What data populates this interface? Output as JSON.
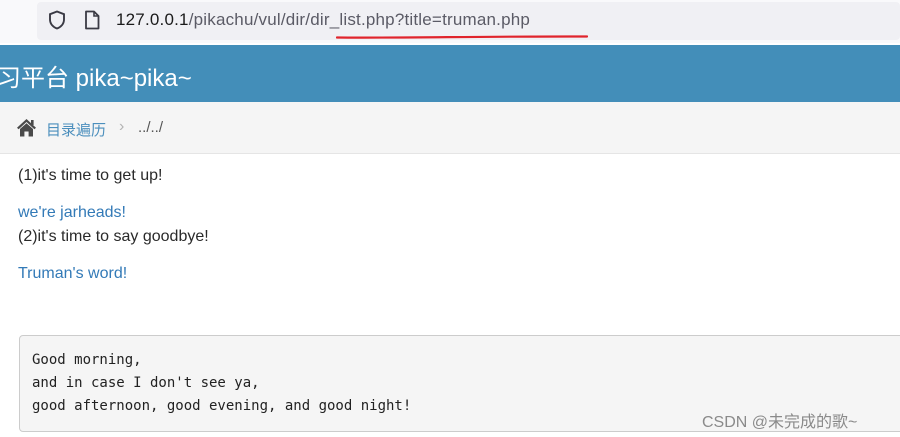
{
  "address_bar": {
    "url_host": "127.0.0.1",
    "url_path": "/pikachu/vul/dir/dir_list.php?title=truman.php",
    "underline_color": "#e0242c"
  },
  "header": {
    "title": "习平台 pika~pika~",
    "background_color": "#438eb9"
  },
  "breadcrumb": {
    "home_icon": "home-icon",
    "link_label": "目录遍历",
    "separator": "›",
    "current": "../../"
  },
  "content": {
    "line1": "(1)it's time to get up!",
    "link1": "we're jarheads!",
    "line2": "(2)it's time to say goodbye!",
    "link2": "Truman's word!",
    "pre_lines": [
      "Good morning,",
      "and in case I don't see ya,",
      "good afternoon, good evening, and good night!"
    ]
  },
  "watermark": "CSDN @未完成的歌~"
}
